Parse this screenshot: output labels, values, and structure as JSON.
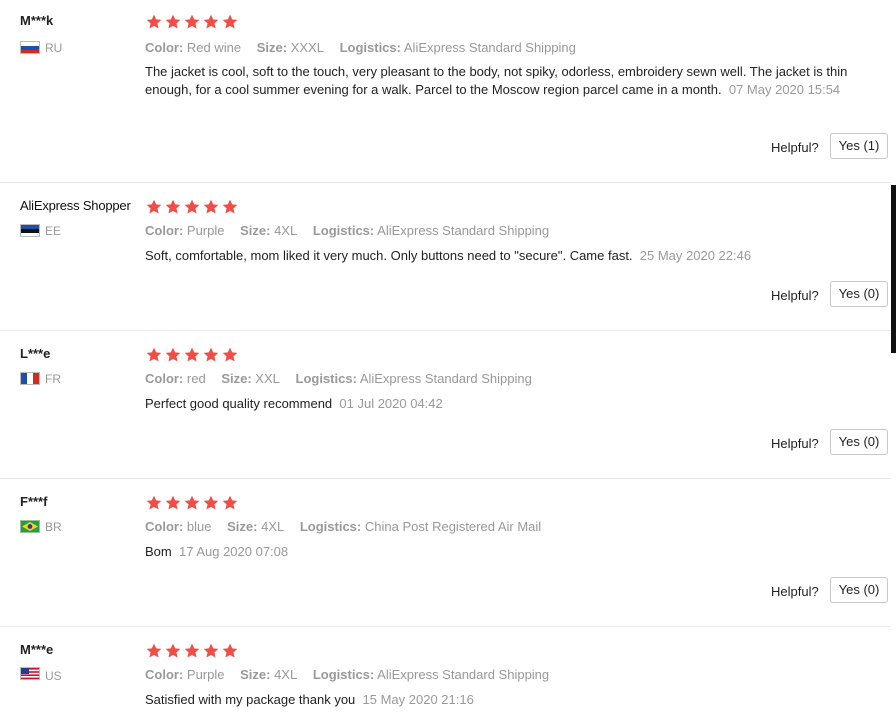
{
  "labels": {
    "color": "Color:",
    "size": "Size:",
    "logistics": "Logistics:",
    "helpful": "Helpful?"
  },
  "colors": {
    "star": "#f04d46",
    "date": "#999999",
    "label": "#999999"
  },
  "reviews": [
    {
      "user": "M***k",
      "country": "RU",
      "flag": "russia-flag-icon",
      "stars": 5,
      "color": "Red wine",
      "size": "XXXL",
      "logistics": "AliExpress Standard Shipping",
      "text": "The jacket is cool, soft to the touch, very pleasant to the body, not spiky, odorless, embroidery sewn well. The jacket is thin enough, for a cool summer evening for a walk. Parcel to the Moscow region parcel came in a month.",
      "date": "07 May 2020 15:54",
      "helpful_label": "Yes (1)"
    },
    {
      "user": "AliExpress Shopper",
      "country": "EE",
      "flag": "estonia-flag-icon",
      "stars": 5,
      "color": "Purple",
      "size": "4XL",
      "logistics": "AliExpress Standard Shipping",
      "text": "Soft, comfortable, mom liked it very much. Only buttons need to \"secure\". Came fast.",
      "date": "25 May 2020 22:46",
      "helpful_label": "Yes (0)"
    },
    {
      "user": "L***e",
      "country": "FR",
      "flag": "france-flag-icon",
      "stars": 5,
      "color": "red",
      "size": "XXL",
      "logistics": "AliExpress Standard Shipping",
      "text": "Perfect good quality recommend",
      "date": "01 Jul 2020 04:42",
      "helpful_label": "Yes (0)"
    },
    {
      "user": "F***f",
      "country": "BR",
      "flag": "brazil-flag-icon",
      "stars": 5,
      "color": "blue",
      "size": "4XL",
      "logistics": "China Post Registered Air Mail",
      "text": "Bom",
      "date": "17 Aug 2020 07:08",
      "helpful_label": "Yes (0)"
    },
    {
      "user": "M***e",
      "country": "US",
      "flag": "usa-flag-icon",
      "stars": 5,
      "color": "Purple",
      "size": "4XL",
      "logistics": "AliExpress Standard Shipping",
      "text": "Satisfied with my package thank you",
      "date": "15 May 2020 21:16"
    }
  ]
}
